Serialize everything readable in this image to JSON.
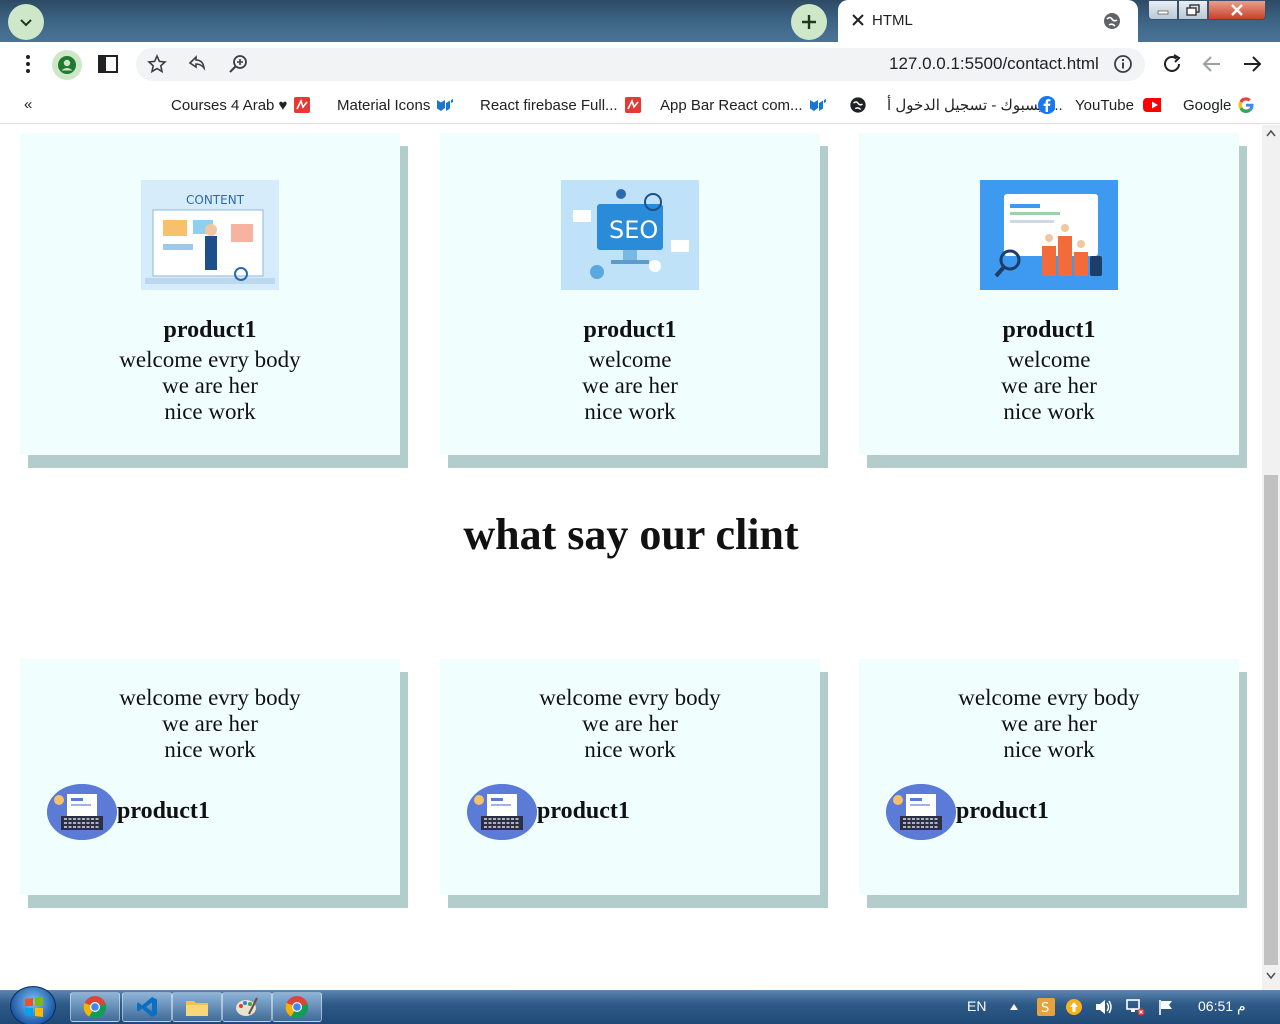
{
  "browser": {
    "tab_title": "HTML",
    "url_host": "127.0.0.1",
    "url_rest": ":5500/contact.html",
    "bookmarks_overflow": "«",
    "bookmarks": [
      {
        "label": "Courses 4 Arab ♥",
        "icon": "arab-icon"
      },
      {
        "label": "Material Icons",
        "icon": "mui-icon"
      },
      {
        "label": "React firebase Full...",
        "icon": "arab-icon"
      },
      {
        "label": "App Bar React com...",
        "icon": "mui-icon"
      },
      {
        "label": "فيسبوك - تسجيل الدخول أ...",
        "icon": "globe-icon"
      },
      {
        "label": "YouTube",
        "icon": "facebook-icon"
      },
      {
        "label": "Google",
        "icon": "youtube-icon"
      }
    ]
  },
  "page": {
    "products": [
      {
        "title": "product1",
        "lines": [
          "welcome evry body",
          "we are her",
          "nice work"
        ],
        "image": "content-illustration"
      },
      {
        "title": "product1",
        "lines": [
          "welcome",
          "we are her",
          "nice work"
        ],
        "image": "seo-illustration"
      },
      {
        "title": "product1",
        "lines": [
          "welcome",
          "we are her",
          "nice work"
        ],
        "image": "ranking-illustration"
      }
    ],
    "section_title": "what say our clint",
    "clients": [
      {
        "lines": [
          "welcome evry body",
          "we are her",
          "nice work"
        ],
        "name": "product1"
      },
      {
        "lines": [
          "welcome evry body",
          "we are her",
          "nice work"
        ],
        "name": "product1"
      },
      {
        "lines": [
          "welcome evry body",
          "we are her",
          "nice work"
        ],
        "name": "product1"
      }
    ]
  },
  "taskbar": {
    "language": "EN",
    "time": "06:51 م"
  }
}
